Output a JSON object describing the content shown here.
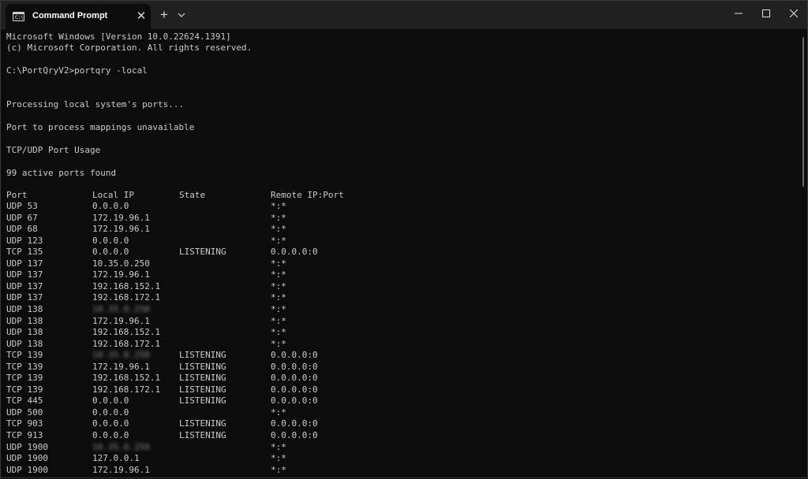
{
  "window": {
    "tab_title": "Command Prompt",
    "tab_icon_glyph": "C:\\",
    "new_tab_glyph": "+",
    "close_tab_glyph": "✕"
  },
  "terminal": {
    "header_lines": [
      "Microsoft Windows [Version 10.0.22624.1391]",
      "(c) Microsoft Corporation. All rights reserved.",
      "",
      "C:\\PortQryV2>portqry -local",
      "",
      "",
      "Processing local system's ports...",
      "",
      "Port to process mappings unavailable",
      "",
      "TCP/UDP Port Usage",
      "",
      "99 active ports found",
      ""
    ],
    "columns": [
      "Port",
      "Local IP",
      "State",
      "Remote IP:Port"
    ],
    "rows": [
      {
        "port": "UDP 53",
        "local_ip": "0.0.0.0",
        "state": "",
        "remote": "*:*"
      },
      {
        "port": "UDP 67",
        "local_ip": "172.19.96.1",
        "state": "",
        "remote": "*:*"
      },
      {
        "port": "UDP 68",
        "local_ip": "172.19.96.1",
        "state": "",
        "remote": "*:*"
      },
      {
        "port": "UDP 123",
        "local_ip": "0.0.0.0",
        "state": "",
        "remote": "*:*"
      },
      {
        "port": "TCP 135",
        "local_ip": "0.0.0.0",
        "state": "LISTENING",
        "remote": "0.0.0.0:0"
      },
      {
        "port": "UDP 137",
        "local_ip": "10.35.0.250",
        "state": "",
        "remote": "*:*"
      },
      {
        "port": "UDP 137",
        "local_ip": "172.19.96.1",
        "state": "",
        "remote": "*:*"
      },
      {
        "port": "UDP 137",
        "local_ip": "192.168.152.1",
        "state": "",
        "remote": "*:*"
      },
      {
        "port": "UDP 137",
        "local_ip": "192.168.172.1",
        "state": "",
        "remote": "*:*"
      },
      {
        "port": "UDP 138",
        "local_ip": "10.35.0.250",
        "state": "",
        "remote": "*:*",
        "blurred": true
      },
      {
        "port": "UDP 138",
        "local_ip": "172.19.96.1",
        "state": "",
        "remote": "*:*"
      },
      {
        "port": "UDP 138",
        "local_ip": "192.168.152.1",
        "state": "",
        "remote": "*:*"
      },
      {
        "port": "UDP 138",
        "local_ip": "192.168.172.1",
        "state": "",
        "remote": "*:*"
      },
      {
        "port": "TCP 139",
        "local_ip": "10.35.0.250",
        "state": "LISTENING",
        "remote": "0.0.0.0:0",
        "blurred": true
      },
      {
        "port": "TCP 139",
        "local_ip": "172.19.96.1",
        "state": "LISTENING",
        "remote": "0.0.0.0:0"
      },
      {
        "port": "TCP 139",
        "local_ip": "192.168.152.1",
        "state": "LISTENING",
        "remote": "0.0.0.0:0"
      },
      {
        "port": "TCP 139",
        "local_ip": "192.168.172.1",
        "state": "LISTENING",
        "remote": "0.0.0.0:0"
      },
      {
        "port": "TCP 445",
        "local_ip": "0.0.0.0",
        "state": "LISTENING",
        "remote": "0.0.0.0:0"
      },
      {
        "port": "UDP 500",
        "local_ip": "0.0.0.0",
        "state": "",
        "remote": "*:*"
      },
      {
        "port": "TCP 903",
        "local_ip": "0.0.0.0",
        "state": "LISTENING",
        "remote": "0.0.0.0:0"
      },
      {
        "port": "TCP 913",
        "local_ip": "0.0.0.0",
        "state": "LISTENING",
        "remote": "0.0.0.0:0"
      },
      {
        "port": "UDP 1900",
        "local_ip": "10.35.0.250",
        "state": "",
        "remote": "*:*",
        "blurred": true
      },
      {
        "port": "UDP 1900",
        "local_ip": "127.0.0.1",
        "state": "",
        "remote": "*:*"
      },
      {
        "port": "UDP 1900",
        "local_ip": "172.19.96.1",
        "state": "",
        "remote": "*:*"
      }
    ]
  },
  "colors": {
    "terminal_bg": "#0c0c0c",
    "terminal_text": "#cccccc",
    "titlebar_bg": "#202020"
  }
}
